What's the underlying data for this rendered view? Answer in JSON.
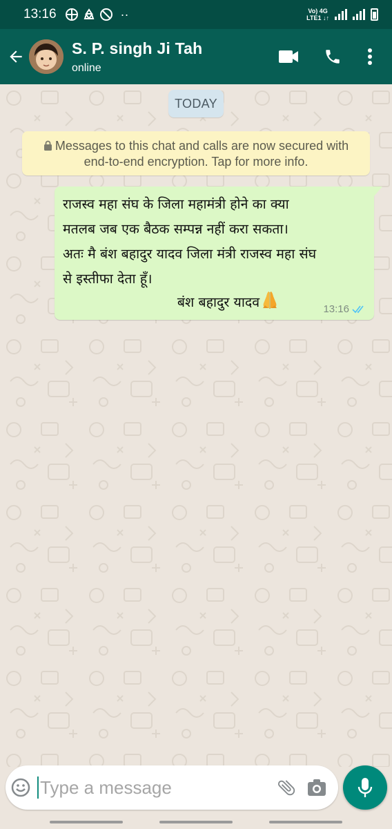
{
  "status_bar": {
    "time": "13:16",
    "network_top": "Vo) 4G",
    "network_bottom": "LTE1 ↓↑",
    "icons": [
      "grid-icon",
      "recycle-icon",
      "no-disturb-icon",
      "more-dots"
    ]
  },
  "header": {
    "contact_name": "S. P. singh Ji Tah",
    "contact_status": "online",
    "background_color": "#075e54",
    "icons": [
      "back-arrow-icon",
      "avatar",
      "video-call-icon",
      "phone-icon",
      "overflow-menu-icon"
    ]
  },
  "chat": {
    "date_chip": "TODAY",
    "encryption_notice": "Messages to this chat and calls are now secured with end-to-end encryption. Tap for more info.",
    "messages": [
      {
        "direction": "outgoing",
        "text": "राजस्व महा संघ के जिला महामंत्री होने का क्या\nमतलब जब एक बैठक सम्पन्न नहीं करा सकता।\nअतः मै बंश बहादुर यादव जिला मंत्री राजस्व महा संघ\nसे इस्तीफा देता हूँ।",
        "signature": "बंश बहादुर यादव",
        "emoji": "folded-hands",
        "time": "13:16",
        "status": "read",
        "bubble_color": "#dcf8c6"
      }
    ]
  },
  "composer": {
    "placeholder": "Type a message",
    "value": "",
    "accent": "#00897b"
  }
}
